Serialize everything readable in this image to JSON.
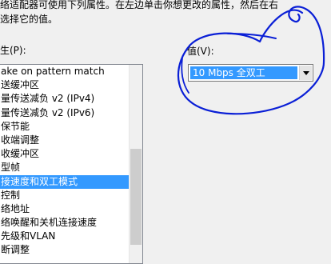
{
  "intro": {
    "line1": "络适配器可使用下列属性。在左边单击你想更改的属性，然后在右",
    "line2": "选择它的值。"
  },
  "property_label": "生(P):",
  "value_label": "值(V):",
  "properties": [
    "ake on pattern match",
    "送缓冲区",
    "量传送减负 v2 (IPv4)",
    "量传送减负 v2 (IPv6)",
    "保节能",
    "收端调整",
    "收缓冲区",
    "型帧",
    "接速度和双工模式",
    "控制",
    "络地址",
    "络唤醒和关机连接速度",
    "先级和VLAN",
    "断调整"
  ],
  "selected_property": "接速度和双工模式",
  "value_combo": {
    "selected": "10 Mbps 全双工"
  },
  "colors": {
    "selection": "#3399ff",
    "annotation_ink": "#0a1fd6"
  }
}
